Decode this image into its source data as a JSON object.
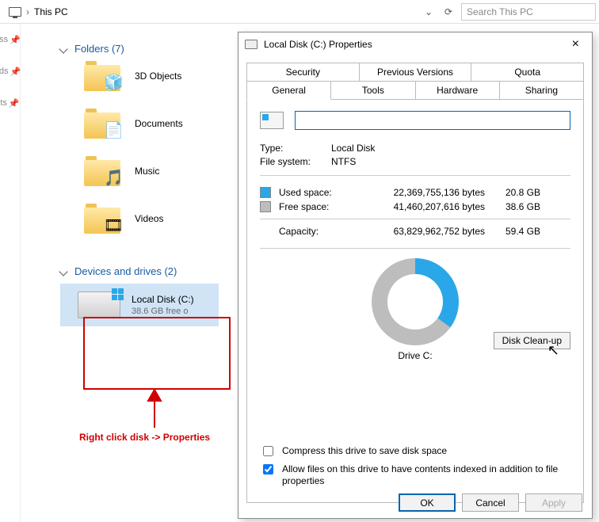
{
  "addrbar": {
    "location": "This PC",
    "search_placeholder": "Search This PC"
  },
  "leftnav": {
    "items": [
      "ss",
      "ds",
      "ts"
    ]
  },
  "sections": {
    "folders": {
      "title": "Folders (7)",
      "items": [
        {
          "label": "3D Objects",
          "glyph": "🧊"
        },
        {
          "label": "Documents",
          "glyph": "📄"
        },
        {
          "label": "Music",
          "glyph": "🎵"
        },
        {
          "label": "Videos",
          "glyph": "🎞"
        }
      ]
    },
    "devices": {
      "title": "Devices and drives (2)",
      "drive": {
        "name": "Local Disk (C:)",
        "subtitle": "38.6 GB free o"
      }
    }
  },
  "annotation": {
    "rightclick_text": "Right click disk -> Properties"
  },
  "dialog": {
    "title": "Local Disk (C:) Properties",
    "tabs_row1": [
      "Security",
      "Previous Versions",
      "Quota"
    ],
    "tabs_row2": [
      "General",
      "Tools",
      "Hardware",
      "Sharing"
    ],
    "active_tab": "General",
    "name_value": "",
    "type_label": "Type:",
    "type_value": "Local Disk",
    "fs_label": "File system:",
    "fs_value": "NTFS",
    "used_label": "Used space:",
    "used_bytes": "22,369,755,136 bytes",
    "used_gb": "20.8 GB",
    "free_label": "Free space:",
    "free_bytes": "41,460,207,616 bytes",
    "free_gb": "38.6 GB",
    "cap_label": "Capacity:",
    "cap_bytes": "63,829,962,752 bytes",
    "cap_gb": "59.4 GB",
    "drive_label": "Drive C:",
    "cleanup_label": "Disk Clean-up",
    "compress_label": "Compress this drive to save disk space",
    "index_label": "Allow files on this drive to have contents indexed in addition to file properties",
    "ok": "OK",
    "cancel": "Cancel",
    "apply": "Apply"
  },
  "chart_data": {
    "type": "pie",
    "title": "Drive C:",
    "series": [
      {
        "name": "Used space",
        "value": 20.8,
        "unit": "GB",
        "color": "#2aa7e8"
      },
      {
        "name": "Free space",
        "value": 38.6,
        "unit": "GB",
        "color": "#bdbdbd"
      }
    ],
    "total": {
      "label": "Capacity",
      "value": 59.4,
      "unit": "GB"
    }
  }
}
